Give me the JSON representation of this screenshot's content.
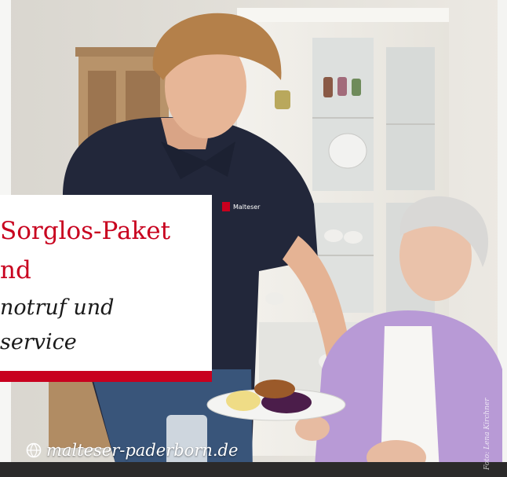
{
  "promo": {
    "headline_line1": "Sorglos-Paket",
    "headline_line2": "nd",
    "subline_line1": "notruf und",
    "subline_line2": "service"
  },
  "footer": {
    "website": "malteser-paderborn.de",
    "globe_icon": "globe-icon"
  },
  "photo": {
    "credit": "Foto: Lena Kirchner",
    "shirt_logo_text": "Malteser"
  },
  "colors": {
    "accent": "#c8001e",
    "shirt": "#22273a",
    "cardigan": "#b89ad6"
  }
}
